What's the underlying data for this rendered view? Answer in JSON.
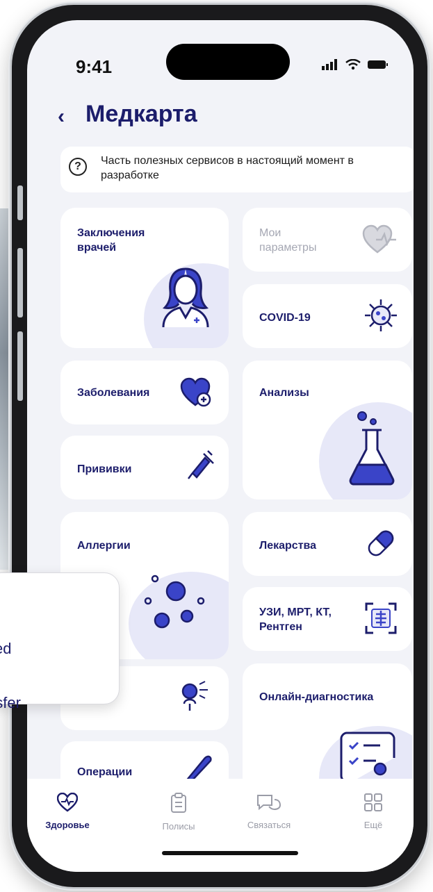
{
  "status": {
    "time": "9:41"
  },
  "header": {
    "back": "‹",
    "title": "Медкарта"
  },
  "notice": {
    "icon": "question-icon",
    "text": "Часть полезных сервисов в настоящий момент в разработке"
  },
  "cards": {
    "conclusions": "Заключения врачей",
    "my_params": "Мои параметры",
    "covid": "COVID-19",
    "diseases": "Заболевания",
    "analyses": "Анализы",
    "vaccinations": "Прививки",
    "allergies": "Аллергии",
    "medicines": "Лекарства",
    "imaging": "УЗИ, МРТ, КТ, Рентген",
    "online_diag": "Онлайн-диагностика",
    "operations": "Операции"
  },
  "tabs": [
    {
      "label": "Здоровье",
      "icon": "heart-pulse-icon",
      "active": true
    },
    {
      "label": "Полисы",
      "icon": "clipboard-icon",
      "active": false
    },
    {
      "label": "Связаться",
      "icon": "chat-icon",
      "active": false
    },
    {
      "label": "Ещё",
      "icon": "grid-icon",
      "active": false
    }
  ],
  "toast": {
    "line1": "ked",
    "line2": "nsfer"
  },
  "colors": {
    "primary": "#1c1d6b",
    "accent": "#3a44c8",
    "blob": "#e7e8f8",
    "background": "#f2f3f8"
  }
}
